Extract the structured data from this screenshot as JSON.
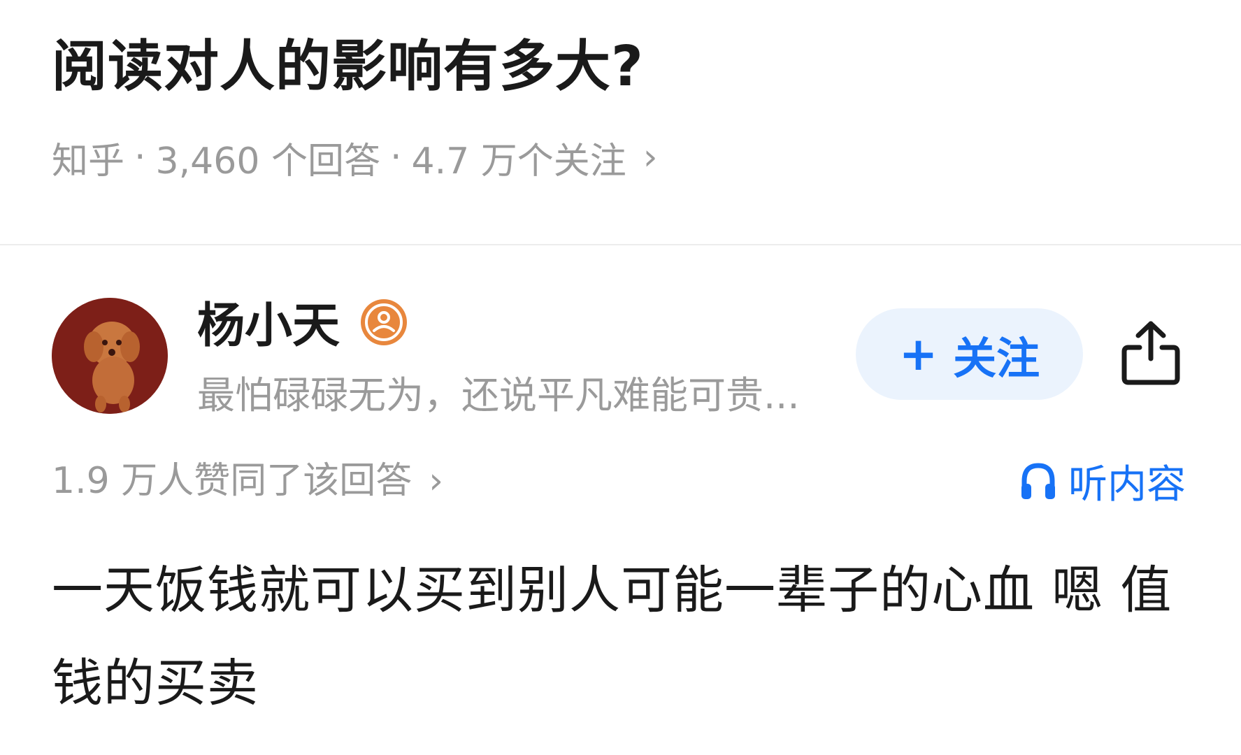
{
  "question": {
    "title": "阅读对人的影响有多大?",
    "source": "知乎",
    "separator": "·",
    "answer_count": "3,460 个回答",
    "follower_count": "4.7 万个关注",
    "chevron": "›"
  },
  "author": {
    "name": "杨小天",
    "badge_icon": "user-badge-icon",
    "bio": "最怕碌碌无为，还说平凡难能可贵...",
    "follow_label": "关注",
    "follow_plus": "+"
  },
  "answer": {
    "upvote_summary": "1.9 万人赞同了该回答",
    "chevron": "›",
    "listen_label": "听内容",
    "body": "一天饭钱就可以买到别人可能一辈子的心血 嗯 值钱的买卖"
  },
  "colors": {
    "accent": "#1772f6",
    "follow_bg": "#ebf3fd",
    "badge": "#e8873d",
    "muted_text": "#9a9a9a",
    "primary_text": "#1a1a1a"
  },
  "icons": {
    "share": "share-icon",
    "listen": "headphones-icon",
    "badge": "user-badge-icon"
  }
}
